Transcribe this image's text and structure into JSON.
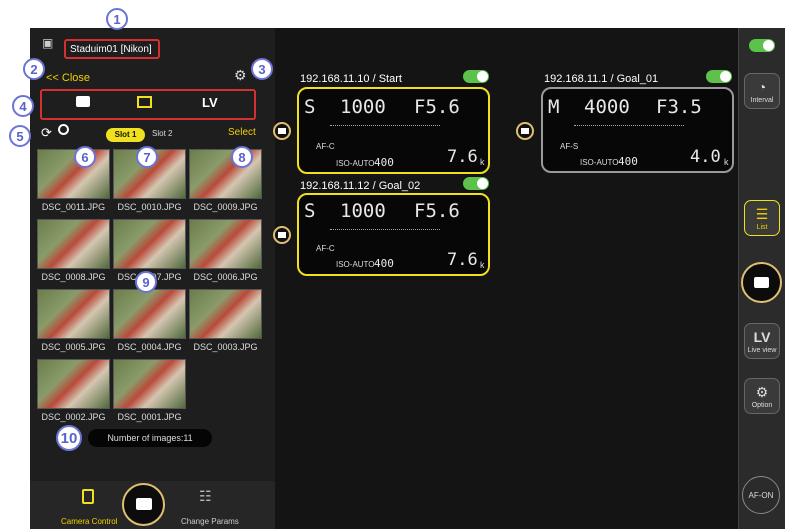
{
  "badges": [
    "1",
    "2",
    "3",
    "4",
    "5",
    "6",
    "7",
    "8",
    "9",
    "10"
  ],
  "header": {
    "title": "Staduim01 [Nikon]",
    "close": "<< Close",
    "mode_tabs": [
      "LV"
    ]
  },
  "slots": {
    "slot1": "Slot 1",
    "slot2": "Slot 2",
    "select": "Select"
  },
  "images": [
    "DSC_0011.JPG",
    "DSC_0010.JPG",
    "DSC_0009.JPG",
    "DSC_0008.JPG",
    "DSC_0007.JPG",
    "DSC_0006.JPG",
    "DSC_0005.JPG",
    "DSC_0004.JPG",
    "DSC_0003.JPG",
    "DSC_0002.JPG",
    "DSC_0001.JPG"
  ],
  "count_text": "Number of images:11",
  "bottom": {
    "camera_control": "Camera Control",
    "change_params": "Change Params"
  },
  "cameras": [
    {
      "title": "192.168.11.10 / Start",
      "mode": "S",
      "shutter": "1000",
      "aperture": "F5.6",
      "af": "AF-C",
      "iso": "ISO-AUTO",
      "iso_val": "400",
      "remaining": "7.6",
      "unit": "k"
    },
    {
      "title": "192.168.11.12 / Goal_02",
      "mode": "S",
      "shutter": "1000",
      "aperture": "F5.6",
      "af": "AF-C",
      "iso": "ISO-AUTO",
      "iso_val": "400",
      "remaining": "7.6",
      "unit": "k"
    },
    {
      "title": "192.168.11.1 / Goal_01",
      "mode": "M",
      "shutter": "4000",
      "aperture": "F3.5",
      "af": "AF-S",
      "iso": "ISO-AUTO",
      "iso_val": "400",
      "remaining": "4.0",
      "unit": "k"
    }
  ],
  "sidebar": {
    "interval": "Interval",
    "list": "List",
    "lv": "LV",
    "live_view": "Live view",
    "option": "Option",
    "af_on": "AF-ON"
  },
  "colors": {
    "accent": "#f0e020",
    "toggle": "#5cc24a",
    "badge": "#5a63c8"
  }
}
